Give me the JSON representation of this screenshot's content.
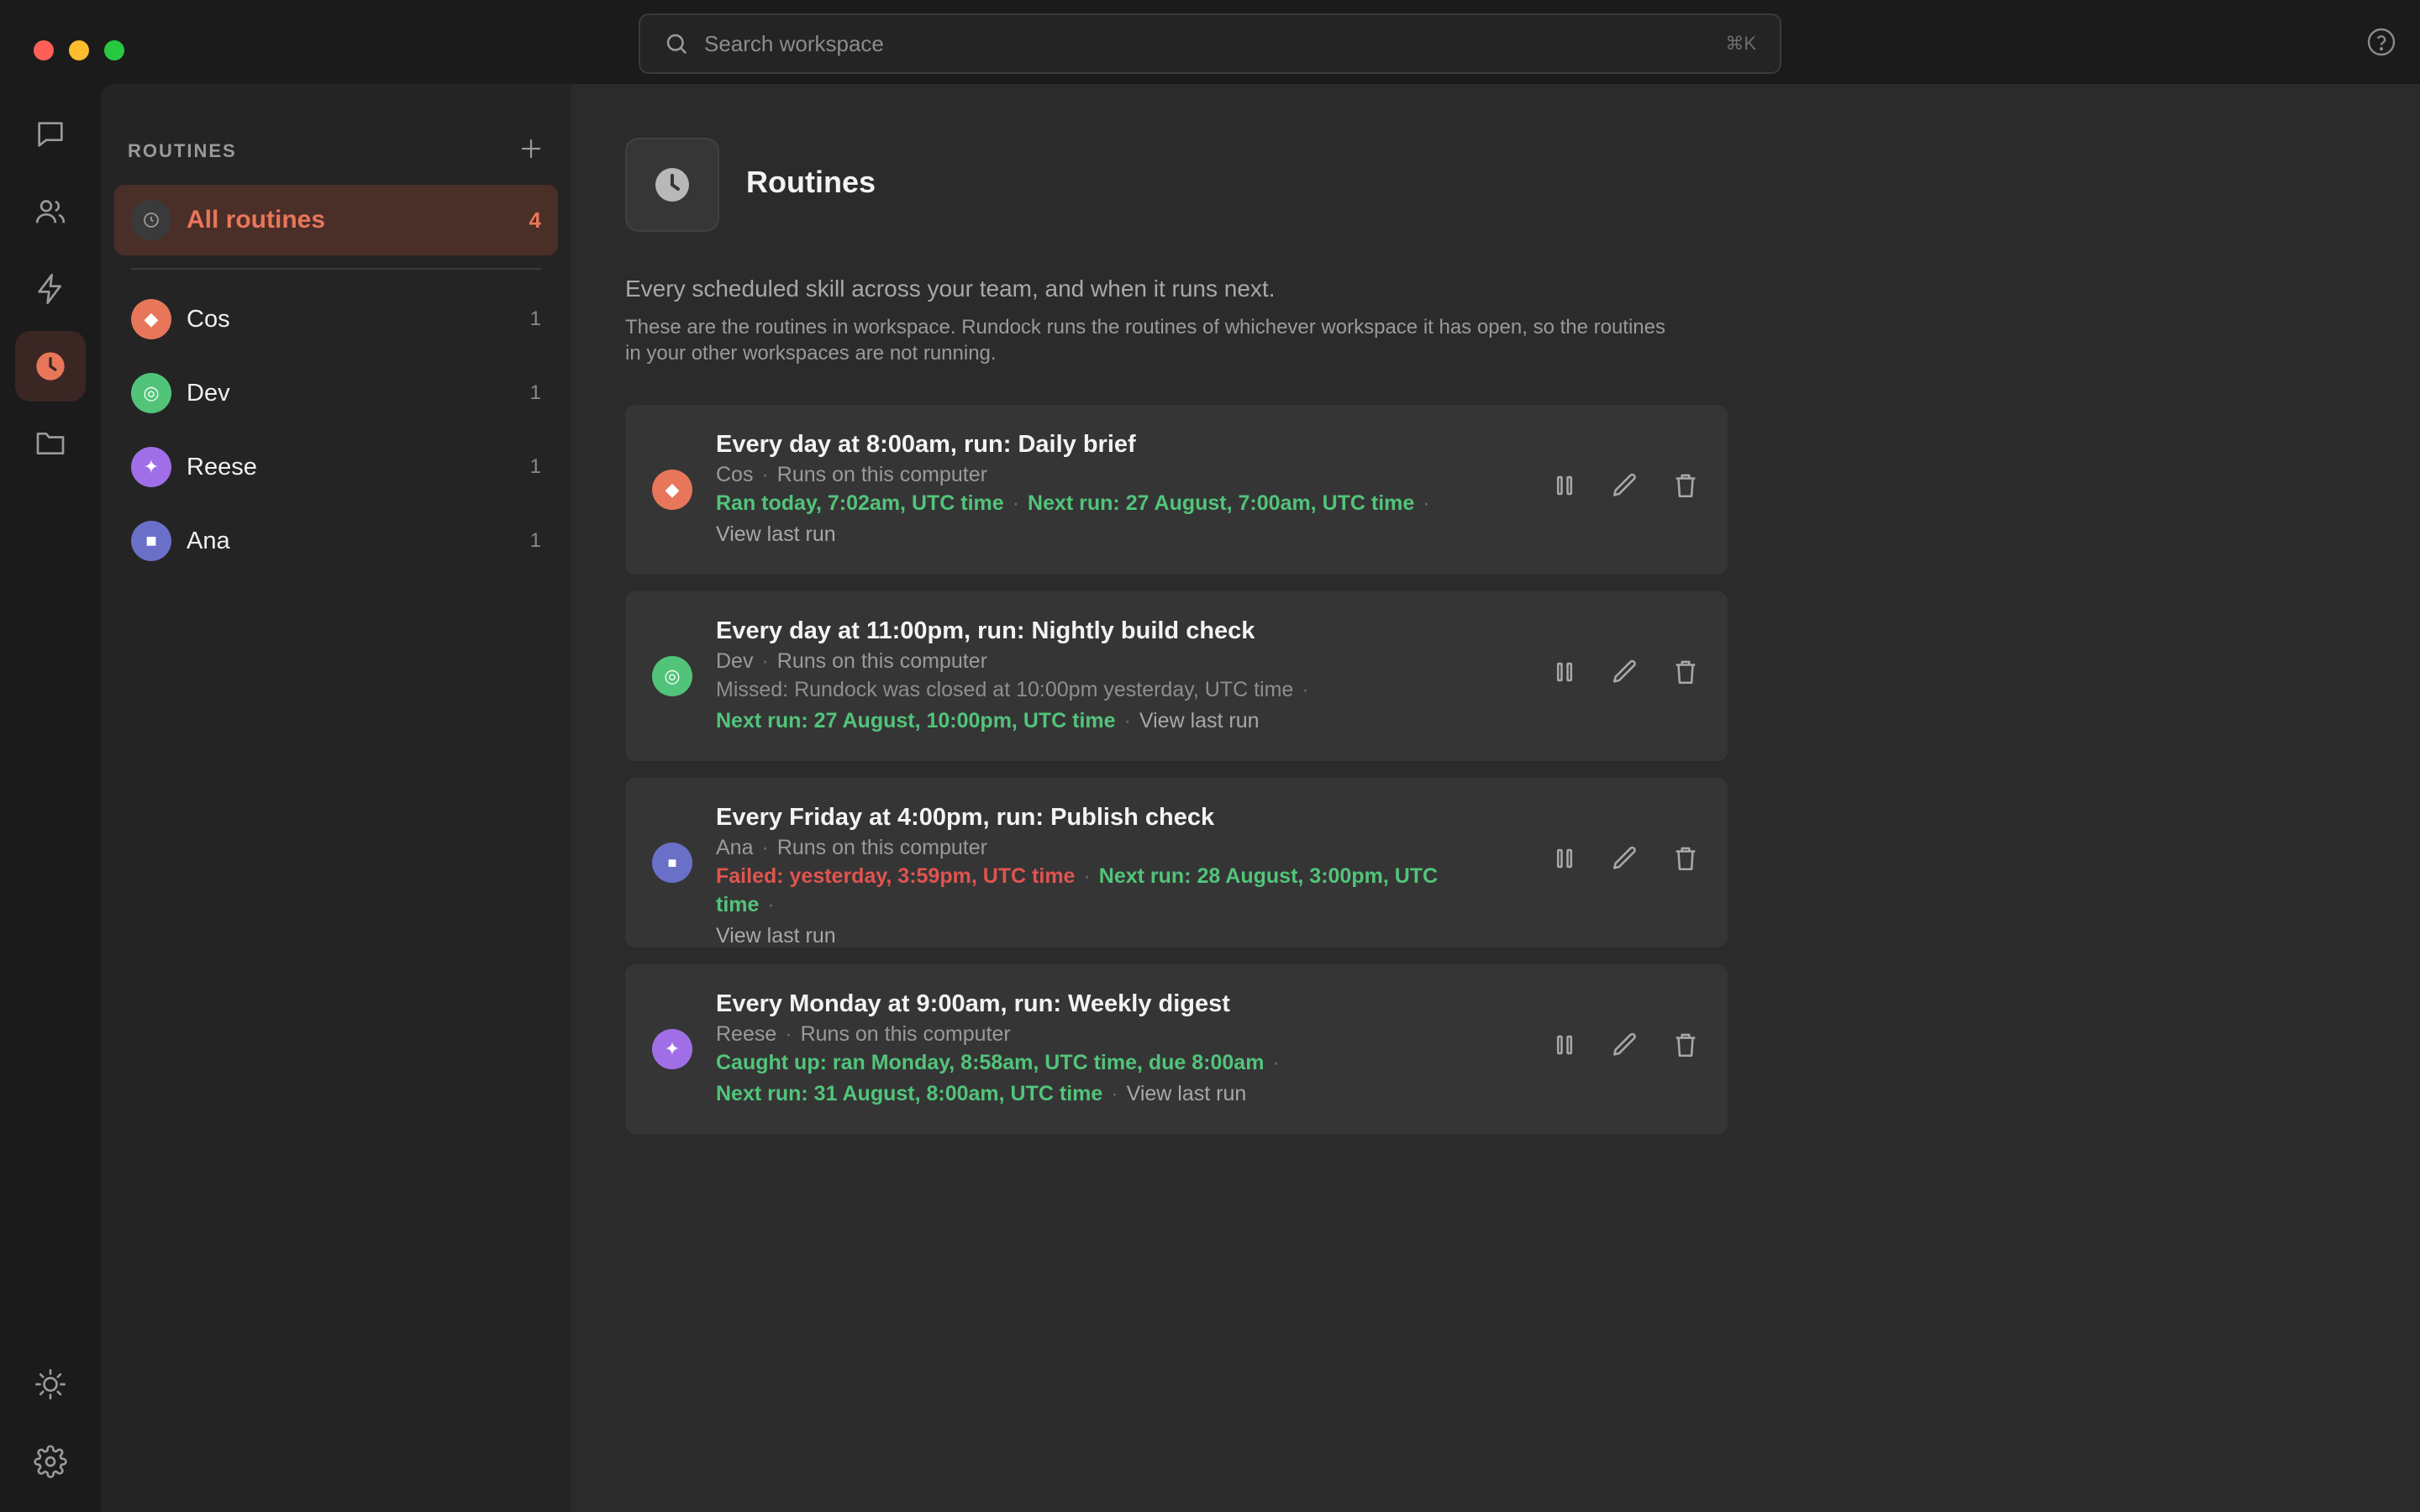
{
  "titlebar": {
    "search_placeholder": "Search workspace",
    "search_shortcut": "⌘K",
    "traffic_colors": [
      "#ff5f57",
      "#febc2e",
      "#28c840"
    ]
  },
  "rail": {
    "items": [
      {
        "icon": "chat-icon",
        "active": false
      },
      {
        "icon": "users-icon",
        "active": false
      },
      {
        "icon": "lightning-icon",
        "active": false
      },
      {
        "icon": "clock-icon",
        "active": true
      },
      {
        "icon": "folder-icon",
        "active": false
      }
    ],
    "bottom": [
      {
        "icon": "sun-icon"
      },
      {
        "icon": "settings-gear-icon"
      }
    ]
  },
  "sidebar": {
    "title": "ROUTINES",
    "all": {
      "label": "All routines",
      "count": "4"
    },
    "items": [
      {
        "label": "Cos",
        "count": "1",
        "color": "#e8765a",
        "icon": "diamond-icon",
        "glyph": "◆"
      },
      {
        "label": "Dev",
        "count": "1",
        "color": "#52c47a",
        "icon": "ring-icon",
        "glyph": "◎"
      },
      {
        "label": "Reese",
        "count": "1",
        "color": "#a06fe8",
        "icon": "sparkle-icon",
        "glyph": "✦"
      },
      {
        "label": "Ana",
        "count": "1",
        "color": "#6a70c8",
        "icon": "square-icon",
        "glyph": "■"
      }
    ]
  },
  "main": {
    "title": "Routines",
    "subtitle": "Every scheduled skill across your team, and when it runs next.",
    "description": "These are the routines in workspace. Rundock runs the routines of whichever workspace it has open, so the routines in your other workspaces are not running.",
    "runs_on": "Runs on this computer",
    "view_last_run": "View last run",
    "routines": [
      {
        "title": "Every day at 8:00am, run: Daily brief",
        "agent": "Cos",
        "line1_a": "Ran today, 7:02am, UTC time",
        "line1_b": "Next run: 27 August, 7:00am, UTC time"
      },
      {
        "title": "Every day at 11:00pm, run: Nightly build check",
        "agent": "Dev",
        "line1": "Missed: Rundock was closed at 10:00pm yesterday, UTC time",
        "line2": "Next run: 27 August, 10:00pm, UTC time"
      },
      {
        "title": "Every Friday at 4:00pm, run: Publish check",
        "agent": "Ana",
        "line1_a": "Failed: yesterday, 3:59pm, UTC time",
        "line1_b": "Next run: 28 August, 3:00pm, UTC time"
      },
      {
        "title": "Every Monday at 9:00am, run: Weekly digest",
        "agent": "Reese",
        "line1": "Caught up: ran Monday, 8:58am, UTC time, due 8:00am",
        "line2": "Next run: 31 August, 8:00am, UTC time"
      }
    ]
  },
  "colors": {
    "accent": "#e8765a",
    "success": "#52c47a",
    "error": "#e0544f"
  }
}
